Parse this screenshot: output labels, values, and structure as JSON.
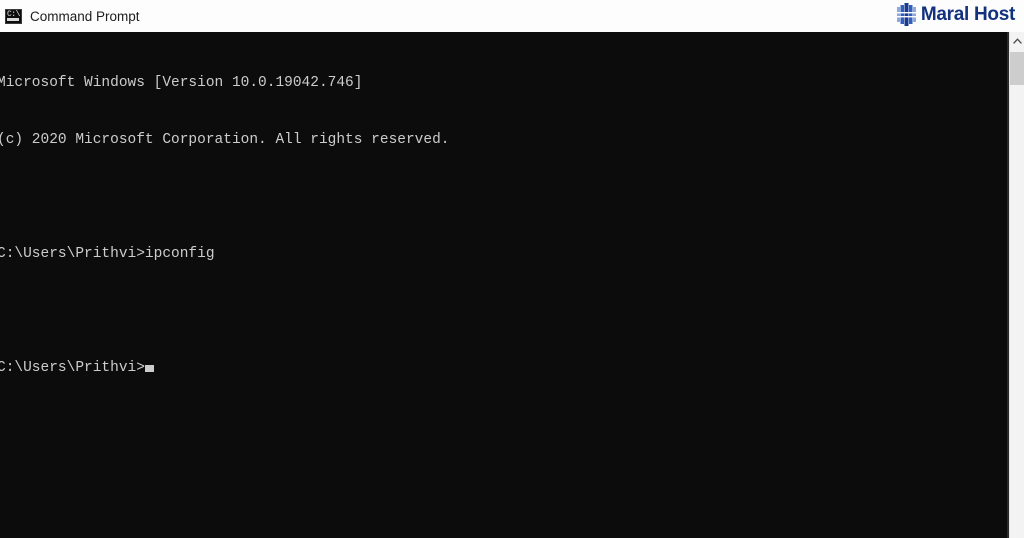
{
  "window": {
    "title": "Command Prompt",
    "icon": "cmd-console-icon",
    "icon_glyph": "C:\\",
    "titlebar_bg": "#fdfdfd",
    "title_color": "#1d1d1d"
  },
  "brand": {
    "name": "Maral Host",
    "mark": "server-rack-icon",
    "color": "#12317e",
    "mark_colors": [
      "#1a3a8f",
      "#2f5fc0",
      "#8fa9dd"
    ]
  },
  "console": {
    "background": "#0c0c0c",
    "foreground": "#cccccc",
    "lines": [
      "Microsoft Windows [Version 10.0.19042.746]",
      "(c) 2020 Microsoft Corporation. All rights reserved.",
      "",
      "C:\\Users\\Prithvi>ipconfig",
      "",
      "C:\\Users\\Prithvi>"
    ],
    "prompt": "C:\\Users\\Prithvi>",
    "last_command": "ipconfig",
    "os_version": "10.0.19042.746",
    "copyright_year": "2020",
    "user": "Prithvi",
    "cursor_visible": true
  },
  "scrollbar": {
    "up_arrow_icon": "chevron-up-icon",
    "track_color": "#f3f3f3",
    "thumb_color": "#cdcdcd",
    "position": "top"
  }
}
